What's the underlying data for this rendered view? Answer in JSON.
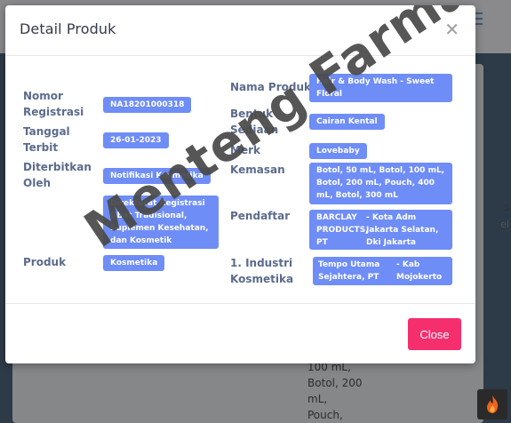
{
  "modal": {
    "title": "Detail Produk",
    "close_icon": "close-icon",
    "close_button": "Close"
  },
  "left_fields": [
    {
      "label": "Nomor\nRegistrasi",
      "value": "NA18201000318"
    },
    {
      "label": "Tanggal\nTerbit",
      "value": "26-01-2023"
    },
    {
      "label": "Diterbitkan\nOleh",
      "value": "Notifikasi Kosmetika",
      "extra": "Direktorat Registrasi Obat Tradisional, Suplemen Kesehatan, dan Kosmetik"
    },
    {
      "label": "Produk",
      "value": "Kosmetika"
    }
  ],
  "right_fields": {
    "nama_produk": {
      "label": "Nama Produk",
      "value": "Hair & Body Wash - Sweet Floral"
    },
    "bentuk_sediaan": {
      "label": "Bentuk\nSediaan",
      "value": "Cairan Kental"
    },
    "merk": {
      "label": "Merk",
      "value": "Lovebaby"
    },
    "kemasan": {
      "label": "Kemasan",
      "value": "Botol, 50 mL, Botol, 100 mL, Botol, 200 mL, Pouch, 400 mL, Botol, 300 mL"
    },
    "pendaftar": {
      "label": "Pendaftar",
      "name": "BARCLAY PRODUCTS, PT",
      "location": "- Kota Adm Jakarta Selatan, Dki Jakarta"
    },
    "industri": {
      "label": "1. Industri\nKosmetika",
      "name": "Tempo Utama Sejahtera, PT",
      "location": "- Kab Mojokerto"
    }
  },
  "watermark": "Menteng Farma",
  "background": {
    "snippet": "100 mL,\nBotol, 200\nmL,\nPouch,",
    "edge_text_1": "s",
    "edge_text_2": "el"
  },
  "colors": {
    "badge": "#6f8df7",
    "close_button": "#f52f6e",
    "label": "#5b6b8c"
  }
}
